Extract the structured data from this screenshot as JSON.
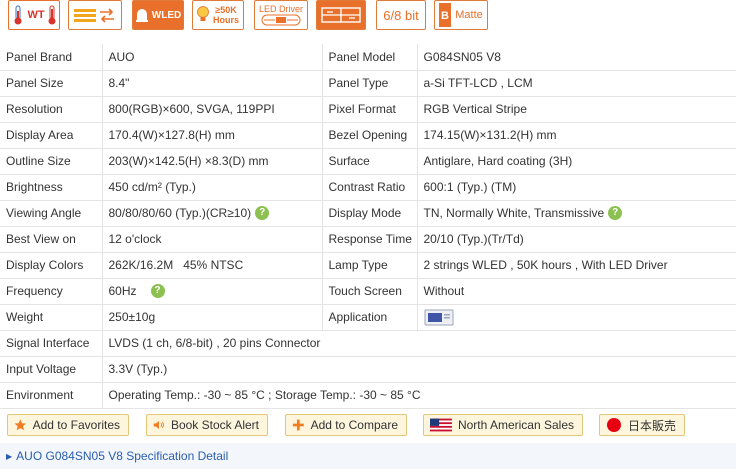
{
  "badges": [
    {
      "icon": "thermometer-icon",
      "label": "WT"
    },
    {
      "icon": "stripe-swap-icon",
      "label": ""
    },
    {
      "icon": "wled-icon",
      "label": "WLED"
    },
    {
      "icon": "bulb-icon",
      "label": "≥50K Hours"
    },
    {
      "icon": "led-driver-icon",
      "label": "LED Driver"
    },
    {
      "icon": "stripe-compare-icon",
      "label": ""
    },
    {
      "icon": "bit-icon",
      "label": "6/8 bit"
    },
    {
      "icon": "matte-icon",
      "label": "Matte"
    }
  ],
  "specs": [
    {
      "l1": "Panel Brand",
      "v1": "AUO",
      "l2": "Panel Model",
      "v2": "G084SN05 V8"
    },
    {
      "l1": "Panel Size",
      "v1": "8.4\"",
      "l2": "Panel Type",
      "v2": "a-Si TFT-LCD , LCM"
    },
    {
      "l1": "Resolution",
      "v1": "800(RGB)×600, SVGA, 119PPI",
      "l2": "Pixel Format",
      "v2": "RGB Vertical Stripe"
    },
    {
      "l1": "Display Area",
      "v1": "170.4(W)×127.8(H) mm",
      "l2": "Bezel Opening",
      "v2": "174.15(W)×131.2(H) mm"
    },
    {
      "l1": "Outline Size",
      "v1": "203(W)×142.5(H) ×8.3(D) mm",
      "l2": "Surface",
      "v2": "Antiglare, Hard coating (3H)"
    },
    {
      "l1": "Brightness",
      "v1": "450 cd/m² (Typ.)",
      "l2": "Contrast Ratio",
      "v2": "600:1 (Typ.) (TM)"
    },
    {
      "l1": "Viewing Angle",
      "v1": "80/80/80/60 (Typ.)(CR≥10)",
      "l2": "Display Mode",
      "v2": "TN, Normally White, Transmissive"
    },
    {
      "l1": "Best View on",
      "v1": "12 o'clock",
      "l2": "Response Time",
      "v2": "20/10 (Typ.)(Tr/Td)"
    },
    {
      "l1": "Display Colors",
      "v1": "262K/16.2M   45% NTSC",
      "l2": "Lamp Type",
      "v2": "2 strings WLED , 50K hours , With LED Driver"
    },
    {
      "l1": "Frequency",
      "v1": "60Hz",
      "l2": "Touch Screen",
      "v2": "Without"
    },
    {
      "l1": "Weight",
      "v1": "250±10g",
      "l2": "Application",
      "v2": ""
    }
  ],
  "full_specs": [
    {
      "l": "Signal Interface",
      "v": "LVDS (1 ch, 6/8-bit) , 20 pins Connector"
    },
    {
      "l": "Input Voltage",
      "v": "3.3V (Typ.)"
    },
    {
      "l": "Environment",
      "v": "Operating Temp.: -30 ~ 85 °C ; Storage Temp.: -30 ~ 85 °C"
    }
  ],
  "help_mark": "?",
  "actions": {
    "favorites": "Add to Favorites",
    "stock_alert": "Book Stock Alert",
    "compare": "Add to Compare",
    "na_sales": "North American Sales",
    "japan_sales": "日本販売"
  },
  "detail_link": "AUO G084SN05 V8 Specification Detail",
  "colors": {
    "badge_orange": "#e8702a",
    "help_green": "#8cc152",
    "link_blue": "#2a5db0",
    "button_bg": "#fdf5dc"
  }
}
